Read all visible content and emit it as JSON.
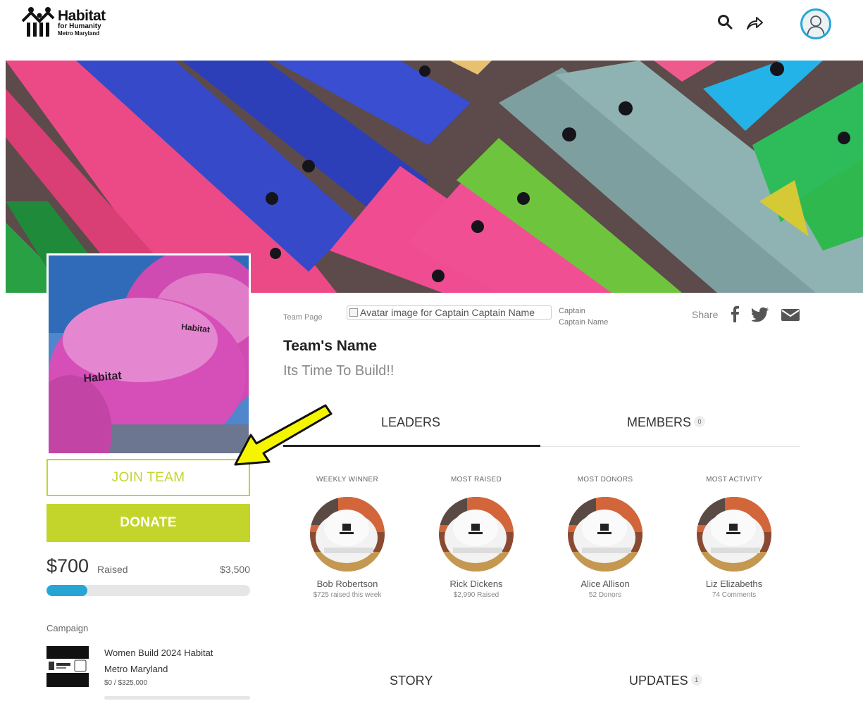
{
  "header": {
    "logo": {
      "line1": "Habitat",
      "line2": "for Humanity",
      "line3": "Metro Maryland"
    },
    "icons": [
      "search-icon",
      "share-icon",
      "user-avatar-icon"
    ]
  },
  "team_page_label": "Team Page",
  "captain": {
    "avatar_alt": "Avatar image for Captain Captain Name",
    "label": "Captain",
    "name": "Captain Name"
  },
  "share": {
    "label": "Share",
    "icons": [
      "facebook-icon",
      "twitter-icon",
      "email-icon"
    ]
  },
  "team": {
    "name": "Team's Name",
    "tagline": "Its Time To Build!!"
  },
  "actions": {
    "join_label": "JOIN TEAM",
    "donate_label": "DONATE"
  },
  "fundraising": {
    "raised": "$700",
    "raised_label": "Raised",
    "goal": "$3,500",
    "progress_fraction": 0.2
  },
  "campaign": {
    "label": "Campaign",
    "title_line1": "Women Build 2024 Habitat",
    "title_line2": "Metro Maryland",
    "amount": "$0 / $325,000"
  },
  "tabs": [
    {
      "label": "LEADERS",
      "active": true
    },
    {
      "label": "MEMBERS",
      "badge": "0",
      "active": false
    }
  ],
  "leaders": [
    {
      "category": "WEEKLY WINNER",
      "name": "Bob Robertson",
      "stat": "$725 raised this week"
    },
    {
      "category": "MOST RAISED",
      "name": "Rick Dickens",
      "stat": "$2,990 Raised"
    },
    {
      "category": "MOST DONORS",
      "name": "Alice Allison",
      "stat": "52 Donors"
    },
    {
      "category": "MOST ACTIVITY",
      "name": "Liz Elizabeths",
      "stat": "74 Comments"
    }
  ],
  "bottom_tabs": [
    {
      "label": "STORY"
    },
    {
      "label": "UPDATES",
      "badge": "1"
    }
  ],
  "colors": {
    "accent_green": "#c3d52a",
    "accent_blue": "#27a6d6",
    "annotation_yellow": "#f5f500"
  }
}
